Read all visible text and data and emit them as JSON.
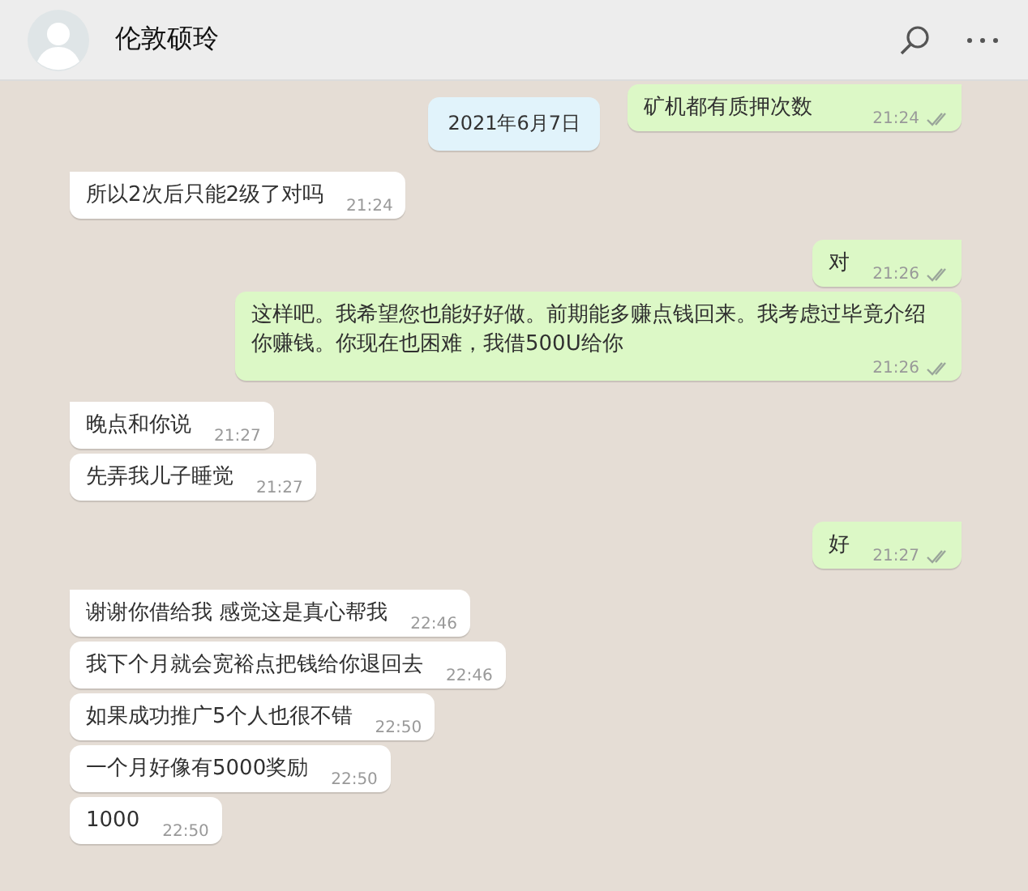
{
  "header": {
    "contact_name": "伦敦硕玲"
  },
  "date_chip": "2021年6月7日",
  "messages": [
    {
      "outgoing": true,
      "tail": true,
      "text": "矿机都有质押次数",
      "time": "21:24"
    },
    {
      "outgoing": false,
      "tail": true,
      "text": "所以2次后只能2级了对吗",
      "time": "21:24"
    },
    {
      "outgoing": true,
      "tail": true,
      "text": "对",
      "time": "21:26"
    },
    {
      "outgoing": true,
      "tail": false,
      "text": "这样吧。我希望您也能好好做。前期能多赚点钱回来。我考虑过毕竟介绍你赚钱。你现在也困难，我借500U给你",
      "time": "21:26"
    },
    {
      "outgoing": false,
      "tail": true,
      "text": "晚点和你说",
      "time": "21:27"
    },
    {
      "outgoing": false,
      "tail": false,
      "text": "先弄我儿子睡觉",
      "time": "21:27"
    },
    {
      "outgoing": true,
      "tail": true,
      "text": "好",
      "time": "21:27"
    },
    {
      "outgoing": false,
      "tail": true,
      "text": "谢谢你借给我 感觉这是真心帮我",
      "time": "22:46"
    },
    {
      "outgoing": false,
      "tail": false,
      "text": "我下个月就会宽裕点把钱给你退回去",
      "time": "22:46"
    },
    {
      "outgoing": false,
      "tail": false,
      "text": "如果成功推广5个人也很不错",
      "time": "22:50"
    },
    {
      "outgoing": false,
      "tail": false,
      "text": "一个月好像有5000奖励",
      "time": "22:50"
    },
    {
      "outgoing": false,
      "tail": false,
      "text": "1000",
      "time": "22:50"
    }
  ]
}
